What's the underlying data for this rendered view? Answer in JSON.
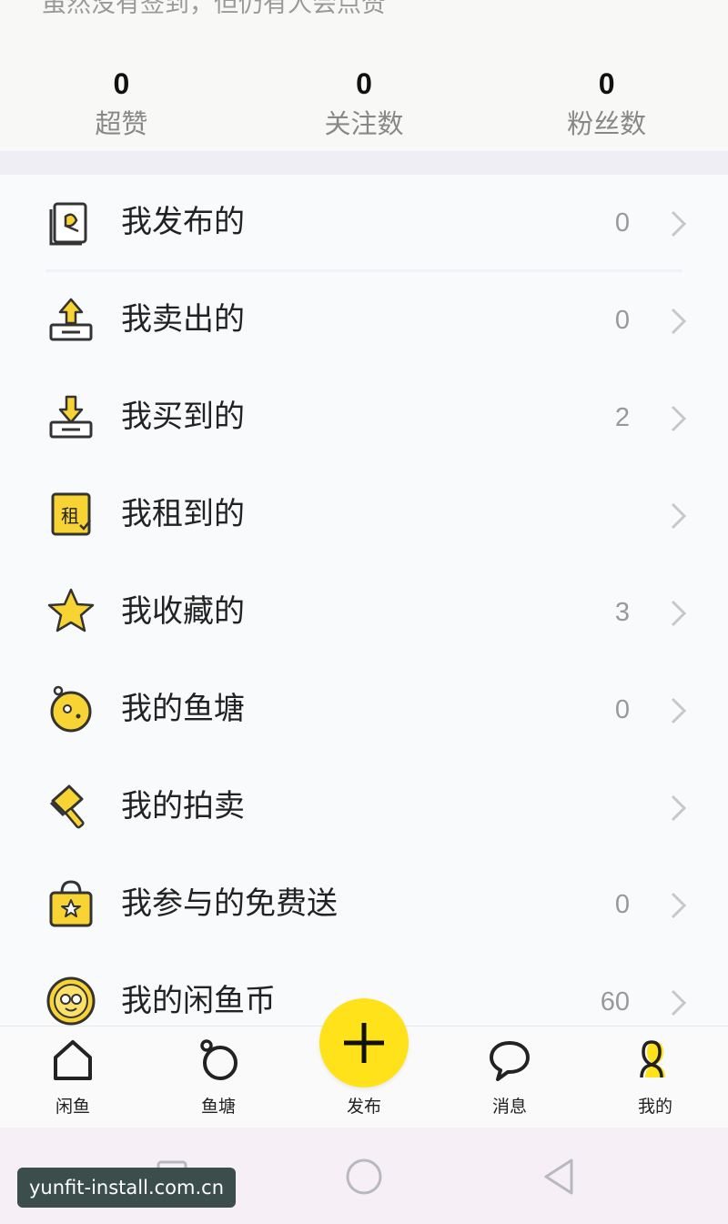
{
  "profile": {
    "bio_text": "虽然没有签到，但仍有人会点赞"
  },
  "stats": [
    {
      "value": "0",
      "label": "超赞"
    },
    {
      "value": "0",
      "label": "关注数"
    },
    {
      "value": "0",
      "label": "粉丝数"
    }
  ],
  "menu": [
    {
      "label": "我发布的",
      "count": "0",
      "icon": "published-doc-icon"
    },
    {
      "label": "我卖出的",
      "count": "0",
      "icon": "sold-tray-icon"
    },
    {
      "label": "我买到的",
      "count": "2",
      "icon": "bought-tray-icon"
    },
    {
      "label": "我租到的",
      "count": "",
      "icon": "rent-icon",
      "icon_text": "租"
    },
    {
      "label": "我收藏的",
      "count": "3",
      "icon": "star-icon"
    },
    {
      "label": "我的鱼塘",
      "count": "0",
      "icon": "fishpond-icon"
    },
    {
      "label": "我的拍卖",
      "count": "",
      "icon": "auction-hammer-icon"
    },
    {
      "label": "我参与的免费送",
      "count": "0",
      "icon": "gift-bag-icon"
    },
    {
      "label": "我的闲鱼币",
      "count": "60",
      "icon": "coin-icon"
    }
  ],
  "tabbar": {
    "tabs": [
      {
        "label": "闲鱼",
        "icon": "home-icon"
      },
      {
        "label": "鱼塘",
        "icon": "fishpond-tab-icon"
      },
      {
        "label": "发布",
        "icon": "plus-icon"
      },
      {
        "label": "消息",
        "icon": "chat-bubble-icon"
      },
      {
        "label": "我的",
        "icon": "profile-icon"
      }
    ]
  },
  "colors": {
    "accent": "#ffe21a",
    "icon_yellow": "#f7d434",
    "text_gray": "#999999"
  },
  "watermark": "yunfit-install.com.cn"
}
